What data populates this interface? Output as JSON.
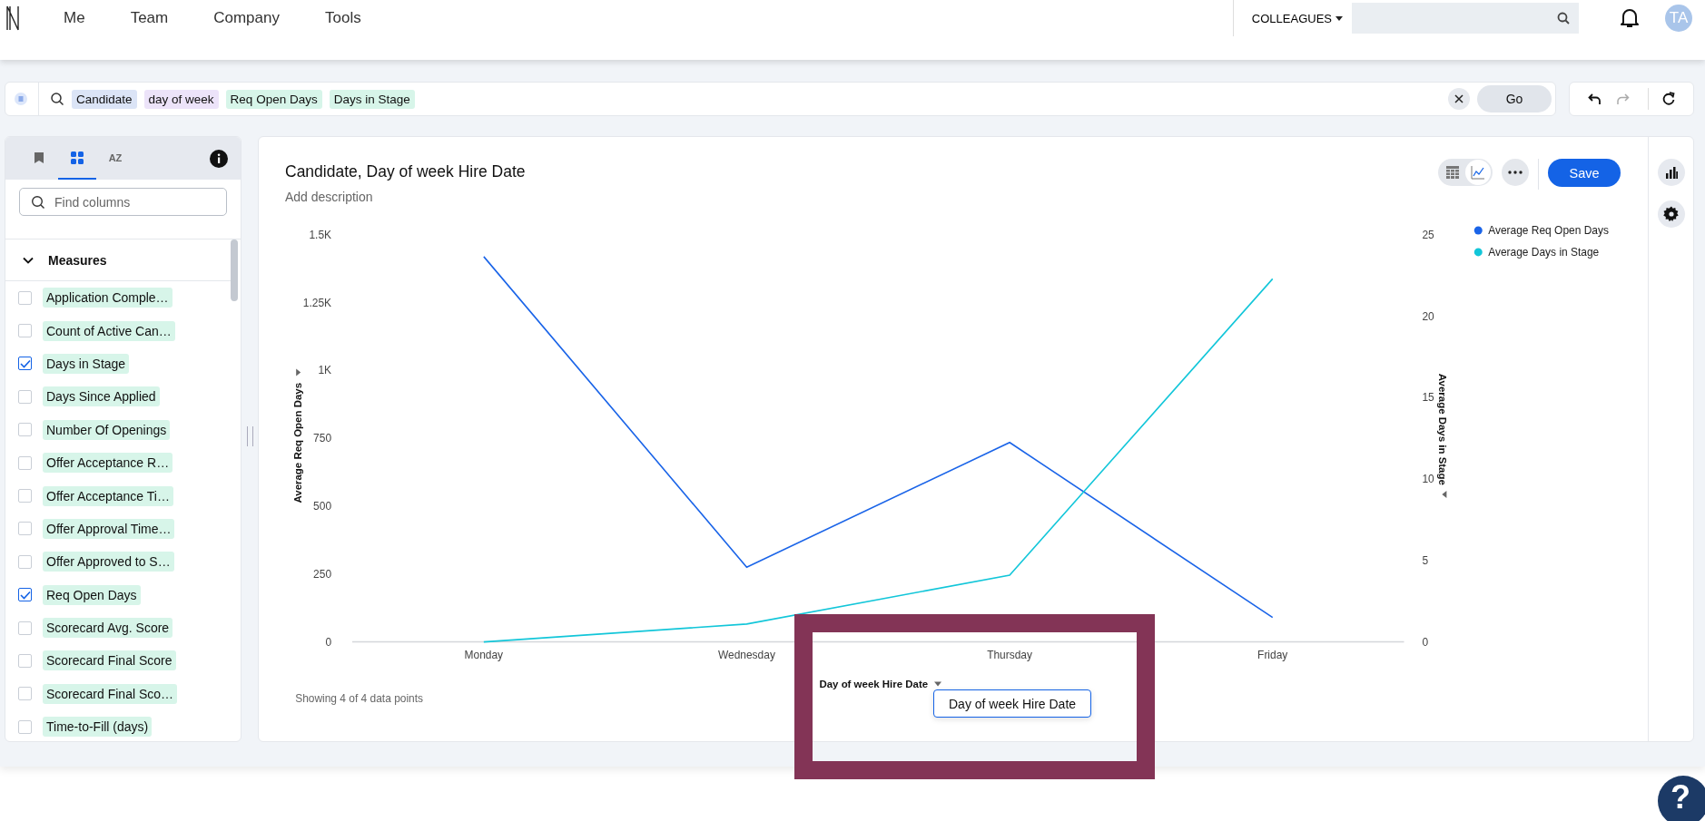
{
  "nav": {
    "items": [
      "Me",
      "Team",
      "Company",
      "Tools"
    ],
    "colleagues": "COLLEAGUES",
    "avatar": "TA"
  },
  "search_bar": {
    "tokens": [
      {
        "label": "Candidate",
        "color": "#dbe4f6"
      },
      {
        "label": "day of week",
        "color": "#ece3f9"
      },
      {
        "label": "Req Open Days",
        "color": "#d7f5e9"
      },
      {
        "label": "Days in Stage",
        "color": "#d7f5e9"
      }
    ],
    "go": "Go"
  },
  "history": {
    "undo_disabled": false,
    "redo_disabled": true
  },
  "left_panel": {
    "tabs": [
      {
        "kind": "bookmark",
        "selected": false
      },
      {
        "kind": "grid",
        "selected": true
      },
      {
        "kind": "az",
        "label": "AZ",
        "selected": false
      }
    ],
    "search": {
      "placeholder": "Find columns"
    },
    "section": {
      "label": "Measures",
      "expanded": true
    },
    "columns": [
      {
        "label": "Application Comple…",
        "checked": false
      },
      {
        "label": "Count of Active Can…",
        "checked": false
      },
      {
        "label": "Days in Stage",
        "checked": true
      },
      {
        "label": "Days Since Applied",
        "checked": false
      },
      {
        "label": "Number Of Openings",
        "checked": false
      },
      {
        "label": "Offer Acceptance R…",
        "checked": false
      },
      {
        "label": "Offer Acceptance Ti…",
        "checked": false
      },
      {
        "label": "Offer Approval Time…",
        "checked": false
      },
      {
        "label": "Offer Approved to S…",
        "checked": false
      },
      {
        "label": "Req Open Days",
        "checked": true
      },
      {
        "label": "Scorecard Avg. Score",
        "checked": false
      },
      {
        "label": "Scorecard Final Score",
        "checked": false
      },
      {
        "label": "Scorecard Final Sco…",
        "checked": false
      },
      {
        "label": "Time-to-Fill (days)",
        "checked": false
      }
    ]
  },
  "chart": {
    "title": "Candidate, Day of week Hire Date",
    "description": "Add description",
    "view_toggle": [
      {
        "kind": "table",
        "selected": false
      },
      {
        "kind": "chart",
        "selected": true
      }
    ],
    "save": "Save",
    "footer": "Showing 4 of 4 data points",
    "tooltip": "Day of week Hire Date",
    "chart_data": {
      "type": "line",
      "xlabel": "Day of week Hire Date",
      "ylabel": "Average Req Open Days",
      "y2label": "Average Days in Stage",
      "categories": [
        "Monday",
        "Wednesday",
        "Thursday",
        "Friday"
      ],
      "series": [
        {
          "name": "Average Req Open Days",
          "color": "#1a64e8",
          "axis": "y",
          "values": [
            1420,
            275,
            735,
            90
          ]
        },
        {
          "name": "Average Days in Stage",
          "color": "#12c6d9",
          "axis": "y2",
          "values": [
            0,
            1.1,
            4.1,
            22.3
          ]
        }
      ],
      "ylim": [
        0,
        1500
      ],
      "yticks": [
        0,
        250,
        500,
        750,
        {
          "value": 1000,
          "label": "1K"
        },
        {
          "value": 1250,
          "label": "1.25K"
        },
        {
          "value": 1500,
          "label": "1.5K"
        }
      ],
      "legend": "top-right",
      "y2lim": [
        0,
        25
      ],
      "y2ticks": [
        0,
        5,
        10,
        15,
        20,
        25
      ]
    }
  },
  "help": "?"
}
